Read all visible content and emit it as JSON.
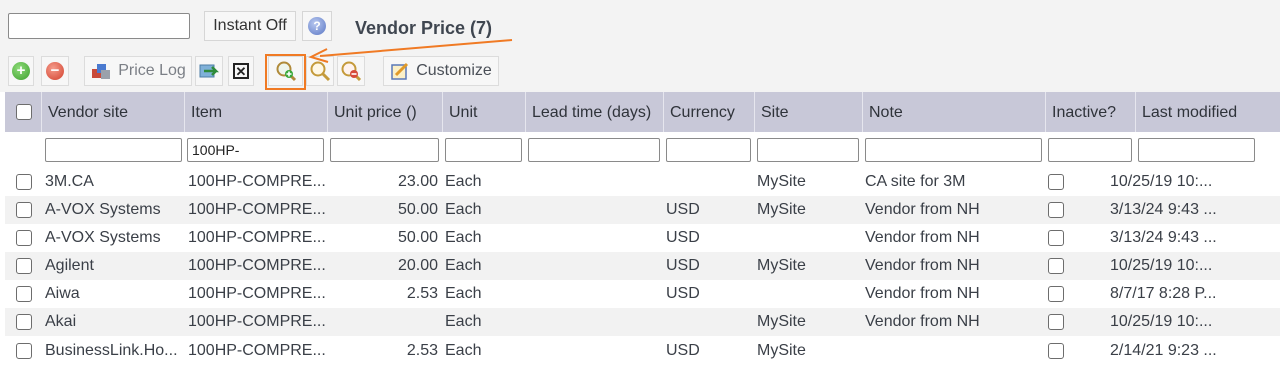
{
  "search": {
    "placeholder": "",
    "value": ""
  },
  "instant_label": "Instant Off",
  "title": "Vendor Price (7)",
  "toolbar": {
    "add_icon": "plus-icon",
    "remove_icon": "minus-icon",
    "price_log_label": "Price Log",
    "customize_label": "Customize"
  },
  "columns": [
    "Vendor site",
    "Item",
    "Unit price ()",
    "Unit",
    "Lead time (days)",
    "Currency",
    "Site",
    "Note",
    "Inactive?",
    "Last modified"
  ],
  "filters": [
    "",
    "100HP-",
    "",
    "",
    "",
    "",
    "",
    "",
    "",
    ""
  ],
  "rows": [
    {
      "vendor_site": "3M.CA",
      "item": "100HP-COMPRE...",
      "unit_price": "23.00",
      "unit": "Each",
      "lead_time": "",
      "currency": "",
      "site": "MySite",
      "note": "CA site for 3M",
      "last_modified": "10/25/19 10:..."
    },
    {
      "vendor_site": "A-VOX Systems",
      "item": "100HP-COMPRE...",
      "unit_price": "50.00",
      "unit": "Each",
      "lead_time": "",
      "currency": "USD",
      "site": "MySite",
      "note": "Vendor from NH",
      "last_modified": "3/13/24 9:43 ..."
    },
    {
      "vendor_site": "A-VOX Systems",
      "item": "100HP-COMPRE...",
      "unit_price": "50.00",
      "unit": "Each",
      "lead_time": "",
      "currency": "USD",
      "site": "",
      "note": "Vendor from NH",
      "last_modified": "3/13/24 9:43 ..."
    },
    {
      "vendor_site": "Agilent",
      "item": "100HP-COMPRE...",
      "unit_price": "20.00",
      "unit": "Each",
      "lead_time": "",
      "currency": "USD",
      "site": "MySite",
      "note": "Vendor from NH",
      "last_modified": "10/25/19 10:..."
    },
    {
      "vendor_site": "Aiwa",
      "item": "100HP-COMPRE...",
      "unit_price": "2.53",
      "unit": "Each",
      "lead_time": "",
      "currency": "USD",
      "site": "",
      "note": "Vendor from NH",
      "last_modified": "8/7/17 8:28 P..."
    },
    {
      "vendor_site": "Akai",
      "item": "100HP-COMPRE...",
      "unit_price": "",
      "unit": "Each",
      "lead_time": "",
      "currency": "",
      "site": "MySite",
      "note": "Vendor from NH",
      "last_modified": "10/25/19 10:..."
    },
    {
      "vendor_site": "BusinessLink.Ho...",
      "item": "100HP-COMPRE...",
      "unit_price": "2.53",
      "unit": "Each",
      "lead_time": "",
      "currency": "USD",
      "site": "MySite",
      "note": "",
      "last_modified": "2/14/21 9:23 ..."
    }
  ],
  "colors": {
    "header_bg": "#c8c8d8",
    "highlight": "#f07a24",
    "row_alt": "#f2f2f2"
  }
}
